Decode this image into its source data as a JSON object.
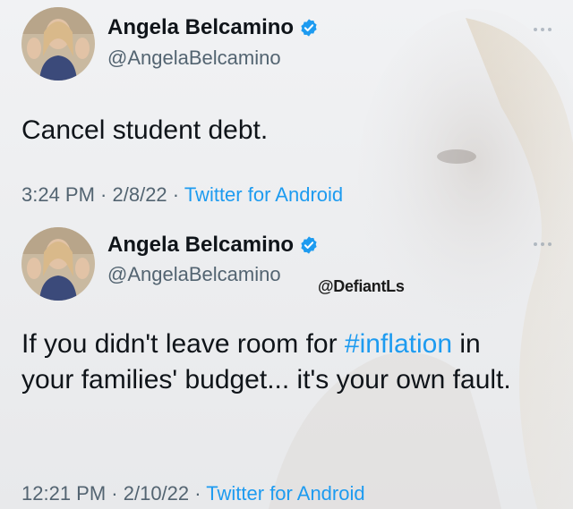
{
  "colors": {
    "accent": "#1d9bf0",
    "text": "#0f1419",
    "muted": "#536471"
  },
  "tweets": [
    {
      "display_name": "Angela Belcamino",
      "handle": "@AngelaBelcamino",
      "verified_icon": "verified-badge-icon",
      "text": "Cancel student debt.",
      "time": "3:24 PM",
      "date": "2/8/22",
      "source": "Twitter for Android"
    },
    {
      "display_name": "Angela Belcamino",
      "handle": "@AngelaBelcamino",
      "verified_icon": "verified-badge-icon",
      "text_before": "If you didn't leave room for ",
      "hashtag": "#inflation",
      "text_after": " in your families' budget... it's your own fault.",
      "time": "12:21 PM",
      "date": "2/10/22",
      "source": "Twitter for Android"
    }
  ],
  "watermark": "@DefiantLs",
  "separator": " · "
}
